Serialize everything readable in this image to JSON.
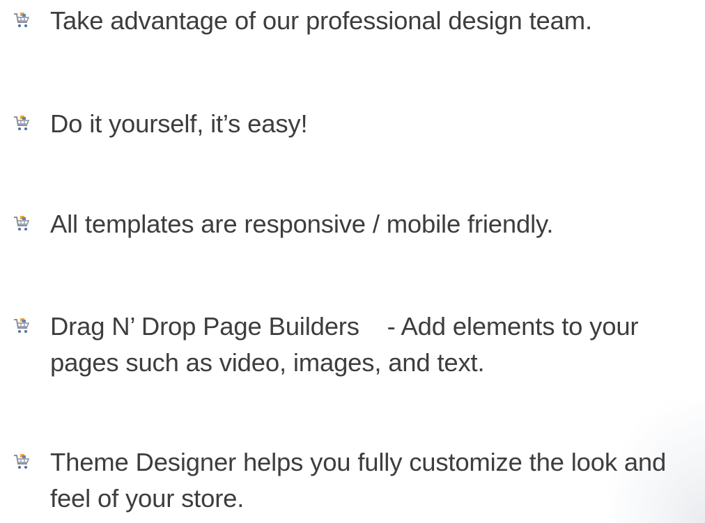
{
  "colors": {
    "text": "#3d3d3d",
    "icon_cart": "#8a8f9c",
    "icon_goods": "#f4a52a",
    "background": "#ffffff"
  },
  "bullet_icon": "shopping-cart-icon",
  "bullets": [
    {
      "text": "Take advantage of our professional design team."
    },
    {
      "text": "Do it yourself, it’s easy!"
    },
    {
      "text": "All templates are responsive / mobile friendly."
    },
    {
      "text": "Drag N’ Drop Page Builders    - Add elements to your pages such as video, images, and text."
    },
    {
      "text": "Theme Designer helps you fully customize the look and feel of your store."
    }
  ]
}
